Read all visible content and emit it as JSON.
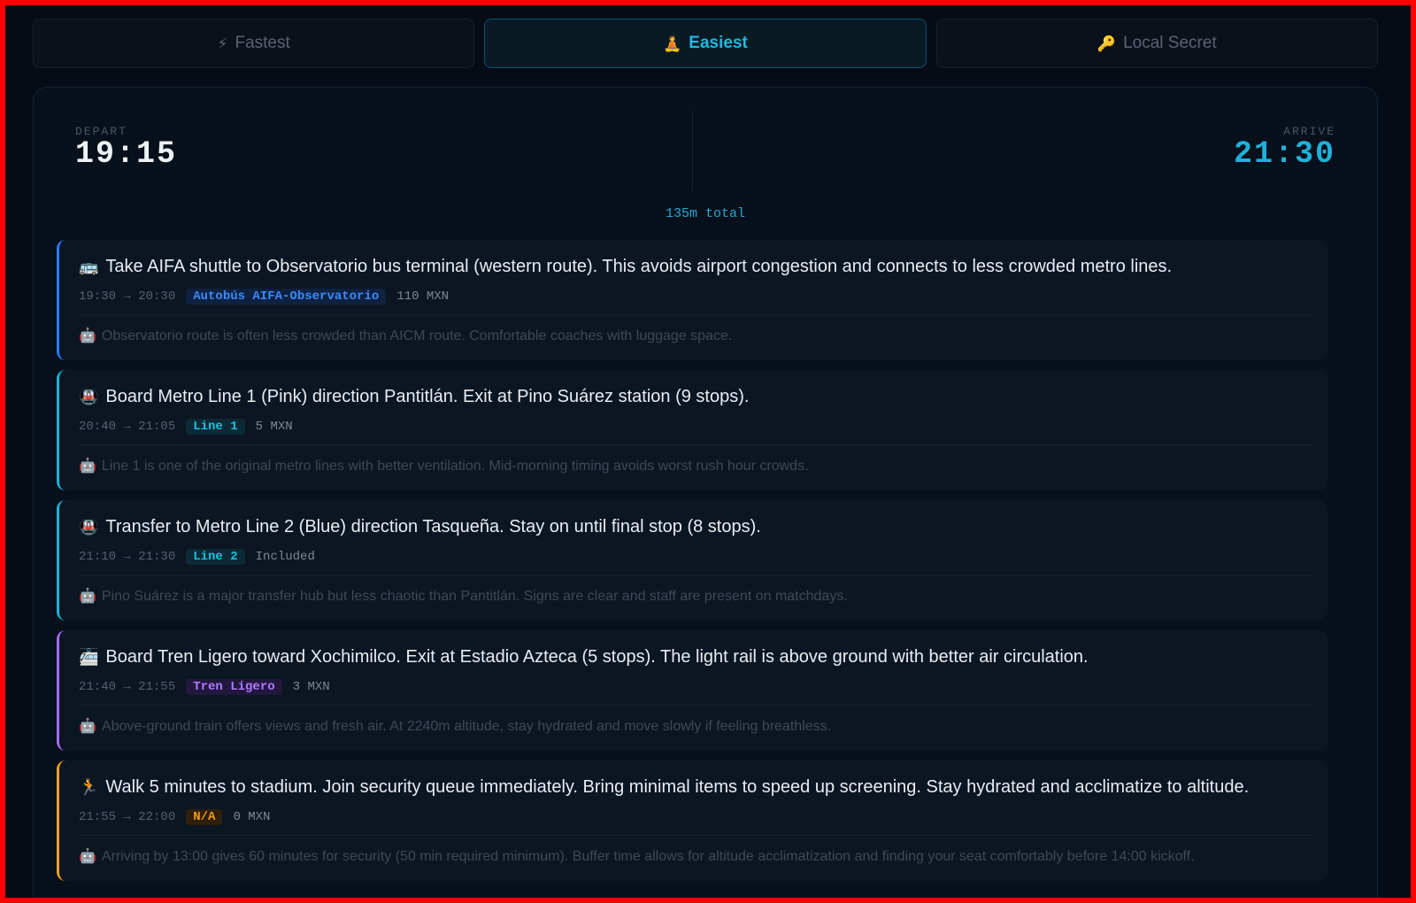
{
  "tabs": [
    {
      "icon": "⚡",
      "icon_name": "lightning-icon",
      "label": "Fastest",
      "active": false
    },
    {
      "icon": "🧘",
      "icon_name": "meditation-icon",
      "label": "Easiest",
      "active": true
    },
    {
      "icon": "🔑",
      "icon_name": "key-icon",
      "label": "Local Secret",
      "active": false
    }
  ],
  "summary": {
    "depart_label": "DEPART",
    "depart_time": "19:15",
    "arrive_label": "ARRIVE",
    "arrive_time": "21:30",
    "total": "135m total"
  },
  "steps": [
    {
      "icon": "🚌",
      "icon_name": "bus-icon",
      "title": "Take AIFA shuttle to Observatorio bus terminal (western route). This avoids airport congestion and connects to less crowded metro lines.",
      "time": "19:30 → 20:30",
      "line": "Autobús AIFA-Observatorio",
      "cost": "110 MXN",
      "tip_icon": "🤖",
      "tip_icon_name": "robot-icon",
      "tip": "Observatorio route is often less crowded than AICM route. Comfortable coaches with luggage space.",
      "accent": "#2a7bff",
      "pill_bg": "#0f2140",
      "pill_color": "#3b8cff"
    },
    {
      "icon": "🚇",
      "icon_name": "metro-icon",
      "title": "Board Metro Line 1 (Pink) direction Pantitlán. Exit at Pino Suárez station (9 stops).",
      "time": "20:40 → 21:05",
      "line": "Line 1",
      "cost": "5 MXN",
      "tip_icon": "🤖",
      "tip_icon_name": "robot-icon",
      "tip": "Line 1 is one of the original metro lines with better ventilation. Mid-morning timing avoids worst rush hour crowds.",
      "accent": "#16b6d4",
      "pill_bg": "#0b2a35",
      "pill_color": "#1cc0e0"
    },
    {
      "icon": "🚇",
      "icon_name": "metro-icon",
      "title": "Transfer to Metro Line 2 (Blue) direction Tasqueña. Stay on until final stop (8 stops).",
      "time": "21:10 → 21:30",
      "line": "Line 2",
      "cost": "Included",
      "tip_icon": "🤖",
      "tip_icon_name": "robot-icon",
      "tip": "Pino Suárez is a major transfer hub but less chaotic than Pantitlán. Signs are clear and staff are present on matchdays.",
      "accent": "#16b6d4",
      "pill_bg": "#0b2a35",
      "pill_color": "#1cc0e0"
    },
    {
      "icon": "🚈",
      "icon_name": "light-rail-icon",
      "title": "Board Tren Ligero toward Xochimilco. Exit at Estadio Azteca (5 stops). The light rail is above ground with better air circulation.",
      "time": "21:40 → 21:55",
      "line": "Tren Ligero",
      "cost": "3 MXN",
      "tip_icon": "🤖",
      "tip_icon_name": "robot-icon",
      "tip": "Above-ground train offers views and fresh air. At 2240m altitude, stay hydrated and move slowly if feeling breathless.",
      "accent": "#a66cf0",
      "pill_bg": "#22173d",
      "pill_color": "#b07cff"
    },
    {
      "icon": "🏃",
      "icon_name": "walking-icon",
      "title": "Walk 5 minutes to stadium. Join security queue immediately. Bring minimal items to speed up screening. Stay hydrated and acclimatize to altitude.",
      "time": "21:55 → 22:00",
      "line": "N/A",
      "cost": "0 MXN",
      "tip_icon": "🤖",
      "tip_icon_name": "robot-icon",
      "tip": "Arriving by 13:00 gives 60 minutes for security (50 min required minimum). Buffer time allows for altitude acclimatization and finding your seat comfortably before 14:00 kickoff.",
      "accent": "#f0a020",
      "pill_bg": "#2e1e0a",
      "pill_color": "#f29a1a"
    }
  ]
}
